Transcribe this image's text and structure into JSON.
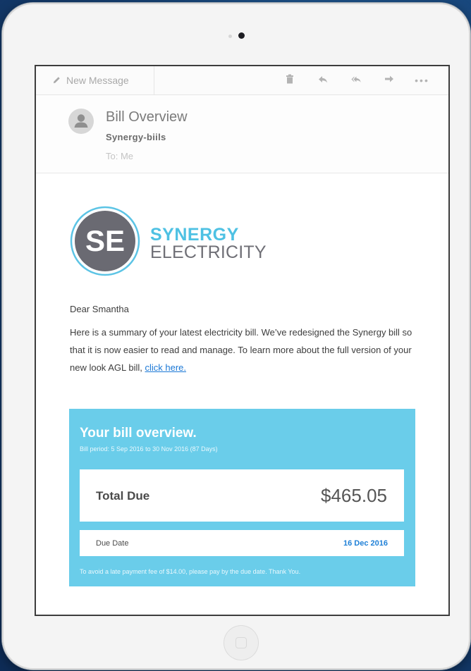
{
  "toolbar": {
    "new_message_label": "New Message",
    "icons": [
      "pencil-icon",
      "trash-icon",
      "reply-icon",
      "reply-all-icon",
      "forward-icon",
      "more-icon"
    ],
    "more_label": "•••"
  },
  "message": {
    "subject": "Bill Overview",
    "sender": "Synergy-biils",
    "recipient": "To: Me"
  },
  "brand": {
    "logo_initials": "SE",
    "name_line1": "SYNERGY",
    "name_line2": "ELECTRICITY",
    "color_primary": "#4ec1e3",
    "color_secondary": "#6f6f76"
  },
  "email_body": {
    "greeting": "Dear Smantha",
    "paragraph": "Here is a summary  of your latest electricity bill. We’ve redesigned the Synergy bill so that it is now easier to read and manage. To learn more about the full version of your new look AGL bill,",
    "link_text": "click here."
  },
  "bill": {
    "title": "Your bill overview.",
    "period": "Bill period: 5 Sep 2016 to 30 Nov 2016 (87 Days)",
    "total_label": "Total Due",
    "total_value": "$465.05",
    "due_label": "Due Date",
    "due_value": "16 Dec 2016",
    "note": "To avoid a late payment fee of $14.00, please pay by the due date. Thank You.",
    "card_color": "#6acdea"
  }
}
